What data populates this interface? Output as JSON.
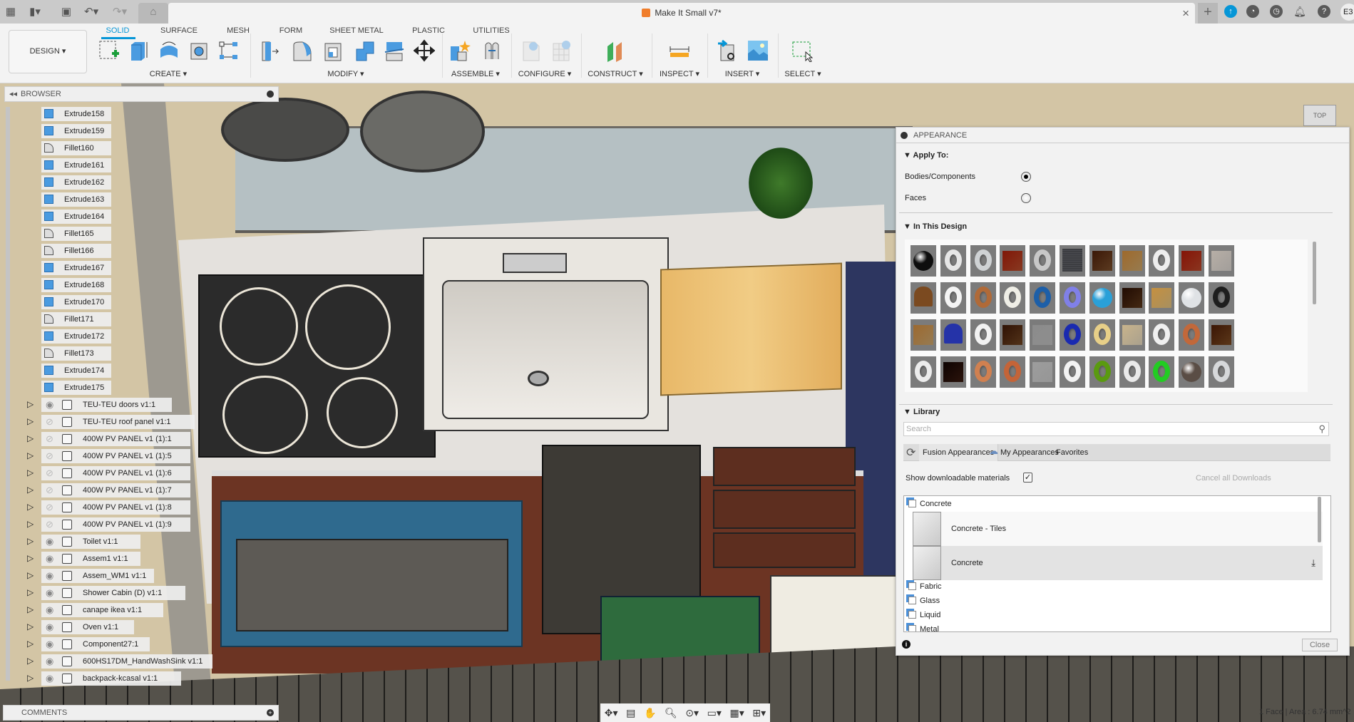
{
  "titlebar": {
    "document_title": "Make It Small v7*",
    "left_icons": [
      "app-grid-icon",
      "file-icon",
      "save-icon",
      "undo-icon",
      "redo-icon",
      "home-icon"
    ],
    "right_icons": [
      "new-tab-icon",
      "update-icon",
      "online-icon",
      "job-status-icon",
      "notifications-icon",
      "help-icon"
    ],
    "user_initials": "E3",
    "close_label": "×"
  },
  "toolbar": {
    "workspace_label": "DESIGN ▾",
    "tabs": [
      {
        "label": "SOLID",
        "active": true
      },
      {
        "label": "SURFACE"
      },
      {
        "label": "MESH"
      },
      {
        "label": "FORM"
      },
      {
        "label": "SHEET METAL"
      },
      {
        "label": "PLASTIC"
      },
      {
        "label": "UTILITIES"
      }
    ],
    "groups": [
      {
        "label": "CREATE ▾"
      },
      {
        "label": "MODIFY ▾"
      },
      {
        "label": "ASSEMBLE ▾"
      },
      {
        "label": "CONFIGURE ▾"
      },
      {
        "label": "CONSTRUCT ▾"
      },
      {
        "label": "INSPECT ▾"
      },
      {
        "label": "INSERT ▾"
      },
      {
        "label": "SELECT ▾"
      }
    ],
    "accent": "#0696d7"
  },
  "browser": {
    "title": "BROWSER",
    "features": [
      {
        "label": "Extrude158",
        "type": "extrude"
      },
      {
        "label": "Extrude159",
        "type": "extrude"
      },
      {
        "label": "Fillet160",
        "type": "fillet"
      },
      {
        "label": "Extrude161",
        "type": "extrude"
      },
      {
        "label": "Extrude162",
        "type": "extrude"
      },
      {
        "label": "Extrude163",
        "type": "extrude"
      },
      {
        "label": "Extrude164",
        "type": "extrude"
      },
      {
        "label": "Fillet165",
        "type": "fillet"
      },
      {
        "label": "Fillet166",
        "type": "fillet"
      },
      {
        "label": "Extrude167",
        "type": "extrude"
      },
      {
        "label": "Extrude168",
        "type": "extrude"
      },
      {
        "label": "Extrude170",
        "type": "extrude"
      },
      {
        "label": "Fillet171",
        "type": "fillet"
      },
      {
        "label": "Extrude172",
        "type": "extrude"
      },
      {
        "label": "Fillet173",
        "type": "fillet"
      },
      {
        "label": "Extrude174",
        "type": "extrude"
      },
      {
        "label": "Extrude175",
        "type": "extrude"
      }
    ],
    "components": [
      {
        "label": "TEU-TEU doors v1:1",
        "visible": true,
        "kind": "grounded"
      },
      {
        "label": "TEU-TEU roof panel v1:1",
        "visible": false,
        "kind": "component"
      },
      {
        "label": "400W PV PANEL v1 (1):1",
        "visible": false,
        "kind": "component"
      },
      {
        "label": "400W PV PANEL v1 (1):5",
        "visible": false,
        "kind": "component"
      },
      {
        "label": "400W PV PANEL v1 (1):6",
        "visible": false,
        "kind": "component"
      },
      {
        "label": "400W PV PANEL v1 (1):7",
        "visible": false,
        "kind": "component"
      },
      {
        "label": "400W PV PANEL v1 (1):8",
        "visible": false,
        "kind": "component"
      },
      {
        "label": "400W PV PANEL v1 (1):9",
        "visible": false,
        "kind": "component"
      },
      {
        "label": "Toilet v1:1",
        "visible": true,
        "kind": "component"
      },
      {
        "label": "Assem1 v1:1",
        "visible": true,
        "kind": "assembly"
      },
      {
        "label": "Assem_WM1 v1:1",
        "visible": true,
        "kind": "assembly"
      },
      {
        "label": "Shower Cabin (D) v1:1",
        "visible": true,
        "kind": "assembly"
      },
      {
        "label": "canape ikea v1:1",
        "visible": true,
        "kind": "component"
      },
      {
        "label": "Oven v1:1",
        "visible": true,
        "kind": "component"
      },
      {
        "label": "Component27:1",
        "visible": true,
        "kind": "component"
      },
      {
        "label": "600HS17DM_HandWashSink v1:1",
        "visible": true,
        "kind": "component"
      },
      {
        "label": "backpack-kcasal v1:1",
        "visible": true,
        "kind": "component"
      }
    ]
  },
  "comments": {
    "title": "COMMENTS"
  },
  "appearance": {
    "title": "APPEARANCE",
    "apply_to": {
      "heading": "Apply To:",
      "options": [
        {
          "label": "Bodies/Components",
          "selected": true
        },
        {
          "label": "Faces",
          "selected": false
        }
      ]
    },
    "in_this_design": {
      "heading": "In This Design",
      "swatches": [
        {
          "shape": "sphere",
          "color": "#0d0d0d"
        },
        {
          "shape": "torus",
          "color": "#e6e6e6"
        },
        {
          "shape": "torus",
          "color": "#cfd2d4"
        },
        {
          "shape": "cube",
          "color": "#b54c2c"
        },
        {
          "shape": "torus",
          "color": "#c8c8c8"
        },
        {
          "shape": "flat",
          "color": "#3d3e42"
        },
        {
          "shape": "cube",
          "color": "#7a4e2b"
        },
        {
          "shape": "cube",
          "color": "#c9a46a"
        },
        {
          "shape": "torus",
          "color": "#eeeeee"
        },
        {
          "shape": "cube",
          "color": "#b8472a"
        },
        {
          "shape": "cube",
          "color": "#d8d3ce"
        },
        {
          "shape": "cloth",
          "color": "#7b4a20"
        },
        {
          "shape": "torus",
          "color": "#f4f4f4"
        },
        {
          "shape": "torus",
          "color": "#b06a38"
        },
        {
          "shape": "torus",
          "color": "#efeee6"
        },
        {
          "shape": "torus",
          "color": "#1d5fa8"
        },
        {
          "shape": "torus",
          "color": "#8080e8"
        },
        {
          "shape": "sphere",
          "color": "#2aa0d8"
        },
        {
          "shape": "cube",
          "color": "#5b3619"
        },
        {
          "shape": "cube",
          "color": "#e0c080"
        },
        {
          "shape": "sphere",
          "color": "#dfe2e5"
        },
        {
          "shape": "torus",
          "color": "#1e1e1e"
        },
        {
          "shape": "cube",
          "color": "#c8a46e"
        },
        {
          "shape": "cloth",
          "color": "#2533a8"
        },
        {
          "shape": "torus",
          "color": "#f2f2f2"
        },
        {
          "shape": "cube",
          "color": "#6e4422"
        },
        {
          "shape": "cube",
          "color": "#bdbdbd"
        },
        {
          "shape": "torus",
          "color": "#1a2ab0"
        },
        {
          "shape": "torus",
          "color": "#e7cf88"
        },
        {
          "shape": "cube",
          "color": "#e2d6bd"
        },
        {
          "shape": "torus",
          "color": "#f0f0f0"
        },
        {
          "shape": "torus",
          "color": "#c2683a"
        },
        {
          "shape": "cube",
          "color": "#7a4a22"
        },
        {
          "shape": "torus",
          "color": "#ececec"
        },
        {
          "shape": "cube",
          "color": "#3a1a10"
        },
        {
          "shape": "torus",
          "color": "#d08050"
        },
        {
          "shape": "torus",
          "color": "#c46438"
        },
        {
          "shape": "cube",
          "color": "#c8c8c8"
        },
        {
          "shape": "torus",
          "color": "#f3f3f3"
        },
        {
          "shape": "torus",
          "color": "#5a9a10"
        },
        {
          "shape": "torus",
          "color": "#eaeaea"
        },
        {
          "shape": "torus",
          "color": "#22cc22"
        },
        {
          "shape": "sphere",
          "color": "#5a4d45"
        },
        {
          "shape": "torus",
          "color": "#d6d8da"
        }
      ]
    },
    "library": {
      "heading": "Library",
      "search_placeholder": "Search",
      "tabs": [
        {
          "label": "Fusion Appearances",
          "active": true
        },
        {
          "label": "My Appearances"
        },
        {
          "label": "Favorites"
        }
      ],
      "show_downloadable_label": "Show downloadable materials",
      "show_downloadable_checked": true,
      "cancel_downloads_label": "Cancel all Downloads",
      "list": [
        {
          "kind": "category",
          "label": "Concrete"
        },
        {
          "kind": "item",
          "label": "Concrete - Tiles"
        },
        {
          "kind": "item",
          "label": "Concrete",
          "selected": true,
          "downloadable": true
        },
        {
          "kind": "category",
          "label": "Fabric"
        },
        {
          "kind": "category",
          "label": "Glass"
        },
        {
          "kind": "category",
          "label": "Liquid"
        },
        {
          "kind": "category",
          "label": "Metal"
        }
      ]
    },
    "close_label": "Close"
  },
  "navbar": {
    "icons": [
      "orbit-icon",
      "look-at-icon",
      "pan-icon",
      "zoom-icon",
      "fit-icon",
      "display-settings-icon",
      "grid-settings-icon",
      "viewports-icon"
    ]
  },
  "status": {
    "selection": "1 Face | Area : 6.74 mm^2"
  },
  "viewcube": {
    "face_label": "TOP"
  }
}
